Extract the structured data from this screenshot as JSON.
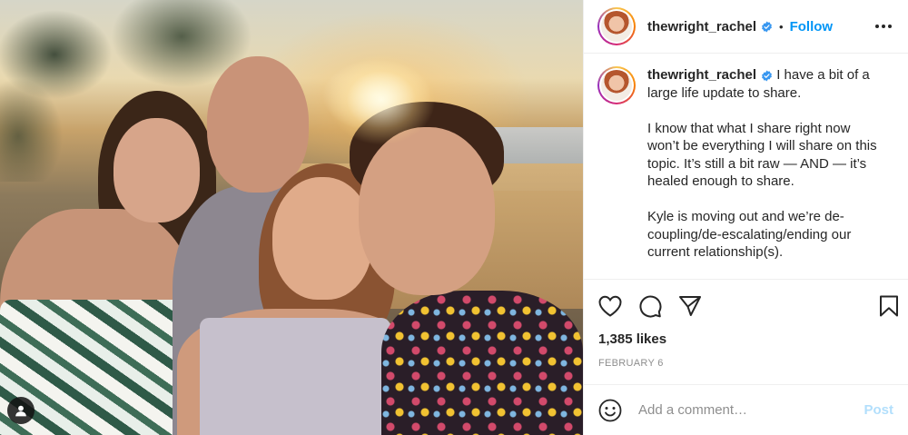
{
  "post": {
    "username": "thewright_rachel",
    "follow_label": "Follow",
    "separator": "•",
    "caption_first_line": "I have a bit of a large life update to share.",
    "caption_paragraphs": [
      "I know that what I share right now won’t be everything I will share on this topic. It’s still a bit raw — AND — it’s healed enough to share.",
      "Kyle is moving out and we’re de-coupling/de-escalating/ending our current relationship(s)."
    ],
    "likes": "1,385 likes",
    "date": "FEBRUARY 6"
  },
  "comment": {
    "placeholder": "Add a comment…",
    "post_label": "Post"
  },
  "icons": {
    "verified": "verified-badge-icon",
    "more": "more-options-icon",
    "like": "heart-icon",
    "comment": "comment-bubble-icon",
    "share": "paper-plane-icon",
    "save": "bookmark-icon",
    "emoji": "emoji-smile-icon",
    "user_tags": "user-tags-icon"
  },
  "colors": {
    "accent": "#0095f6",
    "post_disabled": "#b2dffc",
    "muted": "#8e8e8e",
    "text": "#262626"
  }
}
